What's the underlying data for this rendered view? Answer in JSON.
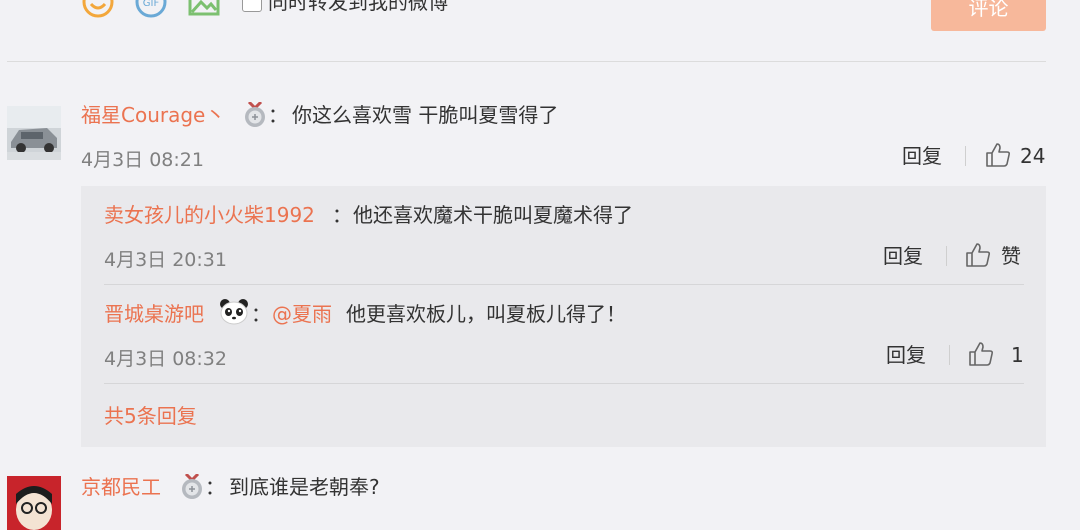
{
  "toolbar": {
    "forward_label": "同时转发到我的微博",
    "submit_label": "评论"
  },
  "comments": [
    {
      "user": "福星Courage丶",
      "sep": "：",
      "text": "你这么喜欢雪 干脆叫夏雪得了",
      "time": "4月3日 08:21",
      "reply_label": "回复",
      "likes": "24",
      "replies": [
        {
          "user": "卖女孩儿的小火柴1992",
          "sep": "：",
          "text": "他还喜欢魔术干脆叫夏魔术得了",
          "time": "4月3日 20:31",
          "reply_label": "回复",
          "likes": "赞"
        },
        {
          "user": "晋城桌游吧",
          "sep": "：",
          "mention": "@夏雨",
          "text": "他更喜欢板儿，叫夏板儿得了！",
          "time": "4月3日 08:32",
          "reply_label": "回复",
          "likes": "1"
        }
      ],
      "more_replies": "共5条回复"
    },
    {
      "user": "京都民工",
      "sep": "：",
      "text": "到底谁是老朝奉?"
    }
  ],
  "colors": {
    "accent": "#eb7350",
    "background": "#f2f2f5",
    "reply_box": "#e9e9ec",
    "submit_disabled": "#f7b89b"
  }
}
